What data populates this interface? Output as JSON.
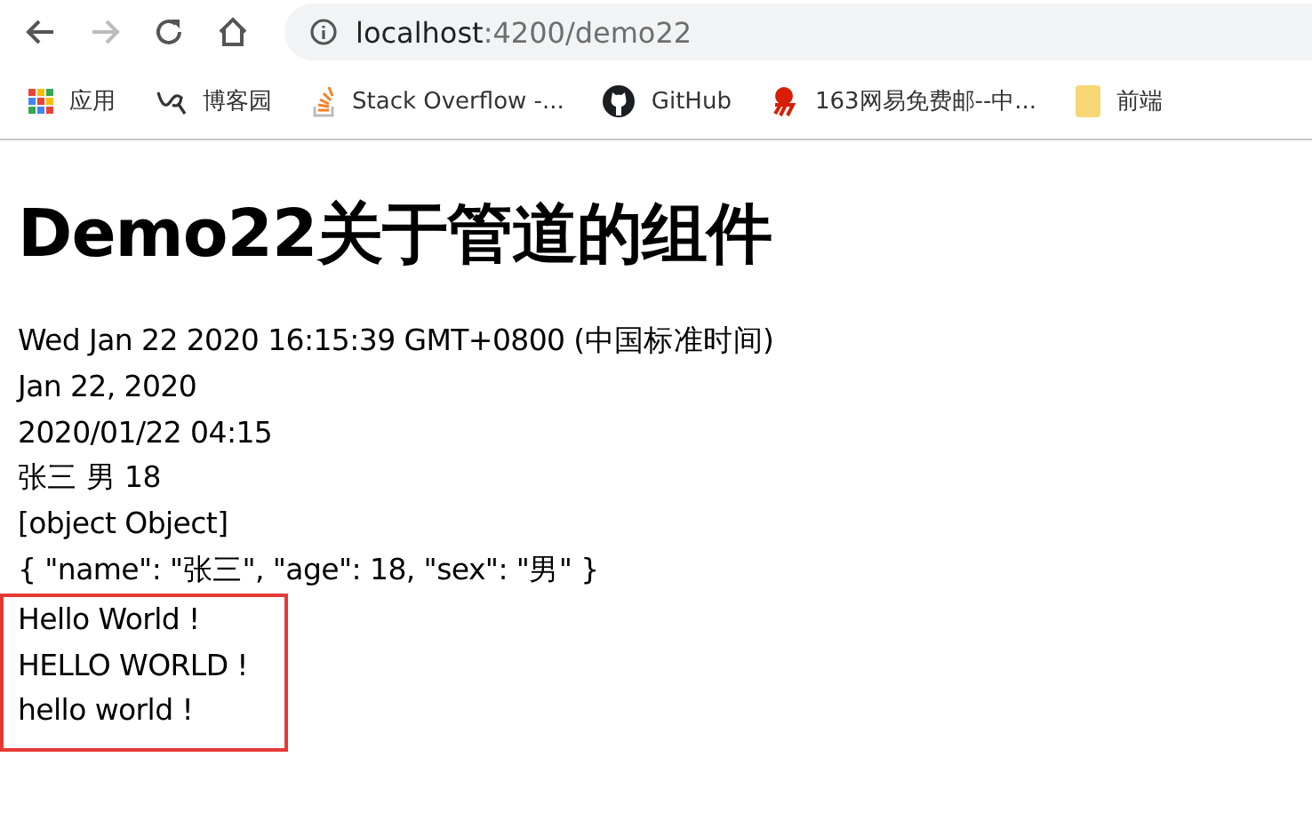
{
  "browser": {
    "url_host": "localhost",
    "url_path": ":4200/demo22",
    "bookmarks": [
      {
        "kind": "apps",
        "label": "应用"
      },
      {
        "kind": "cnblogs",
        "label": "博客园"
      },
      {
        "kind": "stackoverflow",
        "label": "Stack Overflow -..."
      },
      {
        "kind": "github",
        "label": "GitHub"
      },
      {
        "kind": "mail163",
        "label": "163网易免费邮--中..."
      },
      {
        "kind": "folder",
        "label": "前端"
      }
    ]
  },
  "page": {
    "heading": "Demo22关于管道的组件",
    "lines": [
      "Wed Jan 22 2020 16:15:39 GMT+0800 (中国标准时间)",
      "Jan 22, 2020",
      "2020/01/22 04:15",
      "张三 男 18",
      "[object Object]",
      "{ \"name\": \"张三\", \"age\": 18, \"sex\": \"男\" }"
    ],
    "highlighted_lines": [
      "Hello World !",
      "HELLO WORLD !",
      "hello world !"
    ]
  }
}
